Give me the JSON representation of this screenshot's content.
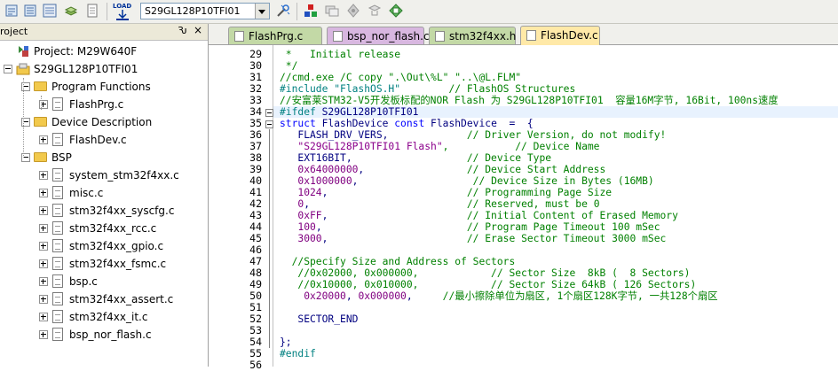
{
  "toolbar": {
    "target_value": "S29GL128P10TFI01",
    "icons": [
      "build-icon",
      "rebuild-icon",
      "batch-build-icon",
      "stop-build-icon",
      "download-icon",
      "target-select",
      "target-options-icon",
      "manage-components-icon",
      "select-packs-icon",
      "options-icon",
      "debug-settings-icon",
      "packs-installer-icon"
    ],
    "load_label": "LOAD"
  },
  "project_panel": {
    "title": "roject",
    "pin_glyph": "Ԅ",
    "close_glyph": "×",
    "root": "Project: M29W640F",
    "target": "S29GL128P10TFI01",
    "groups": [
      {
        "name": "Program Functions",
        "files": [
          "FlashPrg.c"
        ]
      },
      {
        "name": "Device Description",
        "files": [
          "FlashDev.c"
        ]
      },
      {
        "name": "BSP",
        "files": [
          "system_stm32f4xx.c",
          "misc.c",
          "stm32f4xx_syscfg.c",
          "stm32f4xx_rcc.c",
          "stm32f4xx_gpio.c",
          "stm32f4xx_fsmc.c",
          "bsp.c",
          "stm32f4xx_assert.c",
          "stm32f4xx_it.c",
          "bsp_nor_flash.c"
        ]
      }
    ]
  },
  "tabs": [
    {
      "label": "FlashPrg.c",
      "active": false,
      "color": "#c3d9a6"
    },
    {
      "label": "bsp_nor_flash.c",
      "active": false,
      "color": "#d8b7e0"
    },
    {
      "label": "stm32f4xx.h",
      "active": false,
      "color": "#c3d9a6"
    },
    {
      "label": "FlashDev.c",
      "active": true,
      "color": "#ffe9a8"
    }
  ],
  "editor": {
    "current_line": 34,
    "lines": [
      {
        "n": "29",
        "segs": [
          [
            "cmt",
            " *   Initial release"
          ]
        ]
      },
      {
        "n": "30",
        "segs": [
          [
            "cmt",
            " */"
          ]
        ]
      },
      {
        "n": "31",
        "segs": [
          [
            "cmt",
            "//cmd.exe /C copy \".\\Out\\%L\" \"..\\@L.FLM\""
          ]
        ]
      },
      {
        "n": "32",
        "segs": [
          [
            "pp",
            "#include \"FlashOS.H\""
          ],
          [
            "cmt",
            "        // FlashOS Structures"
          ]
        ]
      },
      {
        "n": "33",
        "segs": [
          [
            "cmt",
            "//安富莱STM32-V5开发板标配的NOR Flash 为 S29GL128P10TFI01  容量16M字节, 16Bit, 100ns速度"
          ]
        ]
      },
      {
        "n": "34",
        "segs": [
          [
            "pp",
            "#ifdef "
          ],
          [
            "txt",
            "S29GL128P10TFI01"
          ]
        ]
      },
      {
        "n": "35",
        "segs": [
          [
            "kw",
            "struct"
          ],
          [
            "txt",
            " FlashDevice "
          ],
          [
            "kw",
            "const"
          ],
          [
            "txt",
            " FlashDevice  =  {"
          ]
        ]
      },
      {
        "n": "36",
        "segs": [
          [
            "txt",
            "   FLASH_DRV_VERS,"
          ],
          [
            "cmt",
            "             // Driver Version, do not modify!"
          ]
        ]
      },
      {
        "n": "37",
        "segs": [
          [
            "str",
            "   \"S29GL128P10TFI01 Flash\""
          ],
          [
            "cmt",
            ",           // Device Name"
          ]
        ]
      },
      {
        "n": "38",
        "segs": [
          [
            "txt",
            "   EXT16BIT,"
          ],
          [
            "cmt",
            "                   // Device Type"
          ]
        ]
      },
      {
        "n": "39",
        "segs": [
          [
            "num",
            "   0x64000000"
          ],
          [
            "txt",
            ","
          ],
          [
            "cmt",
            "                 // Device Start Address"
          ]
        ]
      },
      {
        "n": "40",
        "segs": [
          [
            "num",
            "   0x1000000"
          ],
          [
            "txt",
            ","
          ],
          [
            "cmt",
            "                   // Device Size in Bytes (16MB)"
          ]
        ]
      },
      {
        "n": "41",
        "segs": [
          [
            "num",
            "   1024"
          ],
          [
            "txt",
            ","
          ],
          [
            "cmt",
            "                       // Programming Page Size"
          ]
        ]
      },
      {
        "n": "42",
        "segs": [
          [
            "num",
            "   0"
          ],
          [
            "txt",
            ","
          ],
          [
            "cmt",
            "                          // Reserved, must be 0"
          ]
        ]
      },
      {
        "n": "43",
        "segs": [
          [
            "num",
            "   0xFF"
          ],
          [
            "txt",
            ","
          ],
          [
            "cmt",
            "                       // Initial Content of Erased Memory"
          ]
        ]
      },
      {
        "n": "44",
        "segs": [
          [
            "num",
            "   100"
          ],
          [
            "txt",
            ","
          ],
          [
            "cmt",
            "                        // Program Page Timeout 100 mSec"
          ]
        ]
      },
      {
        "n": "45",
        "segs": [
          [
            "num",
            "   3000"
          ],
          [
            "txt",
            ","
          ],
          [
            "cmt",
            "                       // Erase Sector Timeout 3000 mSec"
          ]
        ]
      },
      {
        "n": "46",
        "segs": [
          [
            "txt",
            ""
          ]
        ]
      },
      {
        "n": "47",
        "segs": [
          [
            "cmt",
            "  //Specify Size and Address of Sectors"
          ]
        ]
      },
      {
        "n": "48",
        "segs": [
          [
            "cmt",
            "   //0x02000, 0x000000,            // Sector Size  8kB (  8 Sectors)"
          ]
        ]
      },
      {
        "n": "49",
        "segs": [
          [
            "cmt",
            "   //0x10000, 0x010000,            // Sector Size 64kB ( 126 Sectors)"
          ]
        ]
      },
      {
        "n": "50",
        "segs": [
          [
            "num",
            "    0x20000"
          ],
          [
            "txt",
            ", "
          ],
          [
            "num",
            "0x000000"
          ],
          [
            "txt",
            ","
          ],
          [
            "cmt",
            "     //最小擦除单位为扇区, 1个扇区128K字节, 一共128个扇区"
          ]
        ]
      },
      {
        "n": "51",
        "segs": [
          [
            "txt",
            ""
          ]
        ]
      },
      {
        "n": "52",
        "segs": [
          [
            "txt",
            "   SECTOR_END"
          ]
        ]
      },
      {
        "n": "53",
        "segs": [
          [
            "txt",
            ""
          ]
        ]
      },
      {
        "n": "54",
        "segs": [
          [
            "txt",
            "};"
          ]
        ]
      },
      {
        "n": "55",
        "segs": [
          [
            "pp",
            "#endif"
          ]
        ]
      },
      {
        "n": "56",
        "segs": [
          [
            "txt",
            ""
          ]
        ]
      }
    ]
  }
}
